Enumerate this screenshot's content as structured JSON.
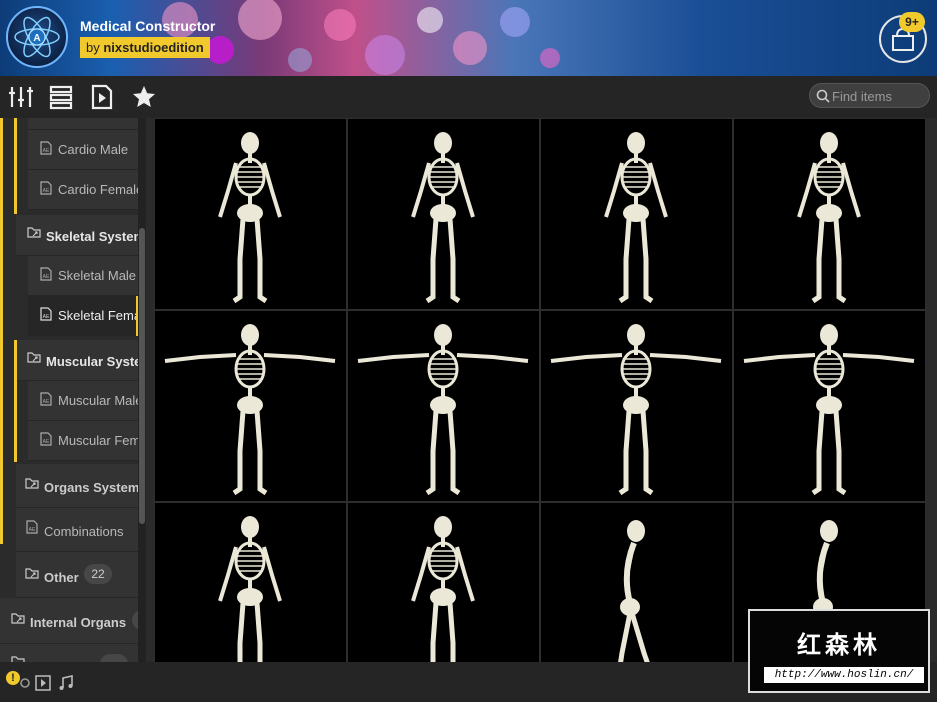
{
  "header": {
    "app_title": "Medical Constructor",
    "author_prefix": "by",
    "author": "nixstudioedition",
    "cart_badge": "9+"
  },
  "toolbar": {
    "icons": [
      "sliders-icon",
      "list-view-icon",
      "play-file-icon",
      "star-icon"
    ],
    "search_placeholder": "Find items"
  },
  "sidebar": {
    "items": [
      {
        "label": "Cardio Male",
        "type": "file",
        "bold": false
      },
      {
        "label": "Cardio Female",
        "type": "file",
        "bold": false
      },
      {
        "label": "Skeletal System",
        "type": "folder",
        "bold": true
      },
      {
        "label": "Skeletal Male",
        "type": "file",
        "bold": false
      },
      {
        "label": "Skeletal Female",
        "type": "file",
        "bold": false,
        "selected": true
      },
      {
        "label": "Muscular System",
        "type": "folder",
        "bold": true
      },
      {
        "label": "Muscular Male",
        "type": "file",
        "bold": false
      },
      {
        "label": "Muscular Female",
        "type": "file",
        "bold": false
      },
      {
        "label": "Organs System",
        "type": "folder",
        "bold": true
      },
      {
        "label": "Combinations",
        "type": "file",
        "bold": false
      },
      {
        "label": "Other",
        "type": "folder",
        "bold": true,
        "count": "22"
      },
      {
        "label": "Internal Organs",
        "type": "folder",
        "bold": true
      }
    ]
  },
  "grid": {
    "rows": 3,
    "columns": 4,
    "poses": [
      "side-left",
      "three-quarter-left",
      "front-arms-down",
      "front-arms-down",
      "t-pose-left",
      "t-pose-front",
      "t-pose-front",
      "t-pose-right",
      "front-standing",
      "front-standing",
      "side-walk",
      "side-walk"
    ]
  },
  "bottombar": {
    "icons": [
      "warning-icon",
      "video-file-icon",
      "music-note-icon",
      "fullscreen-icon"
    ]
  },
  "watermark": {
    "title": "红森林",
    "url": "http://www.hoslin.cn/"
  },
  "colors": {
    "accent": "#f2c92c",
    "panel": "#2b2b2b",
    "toolbar": "#252525"
  }
}
